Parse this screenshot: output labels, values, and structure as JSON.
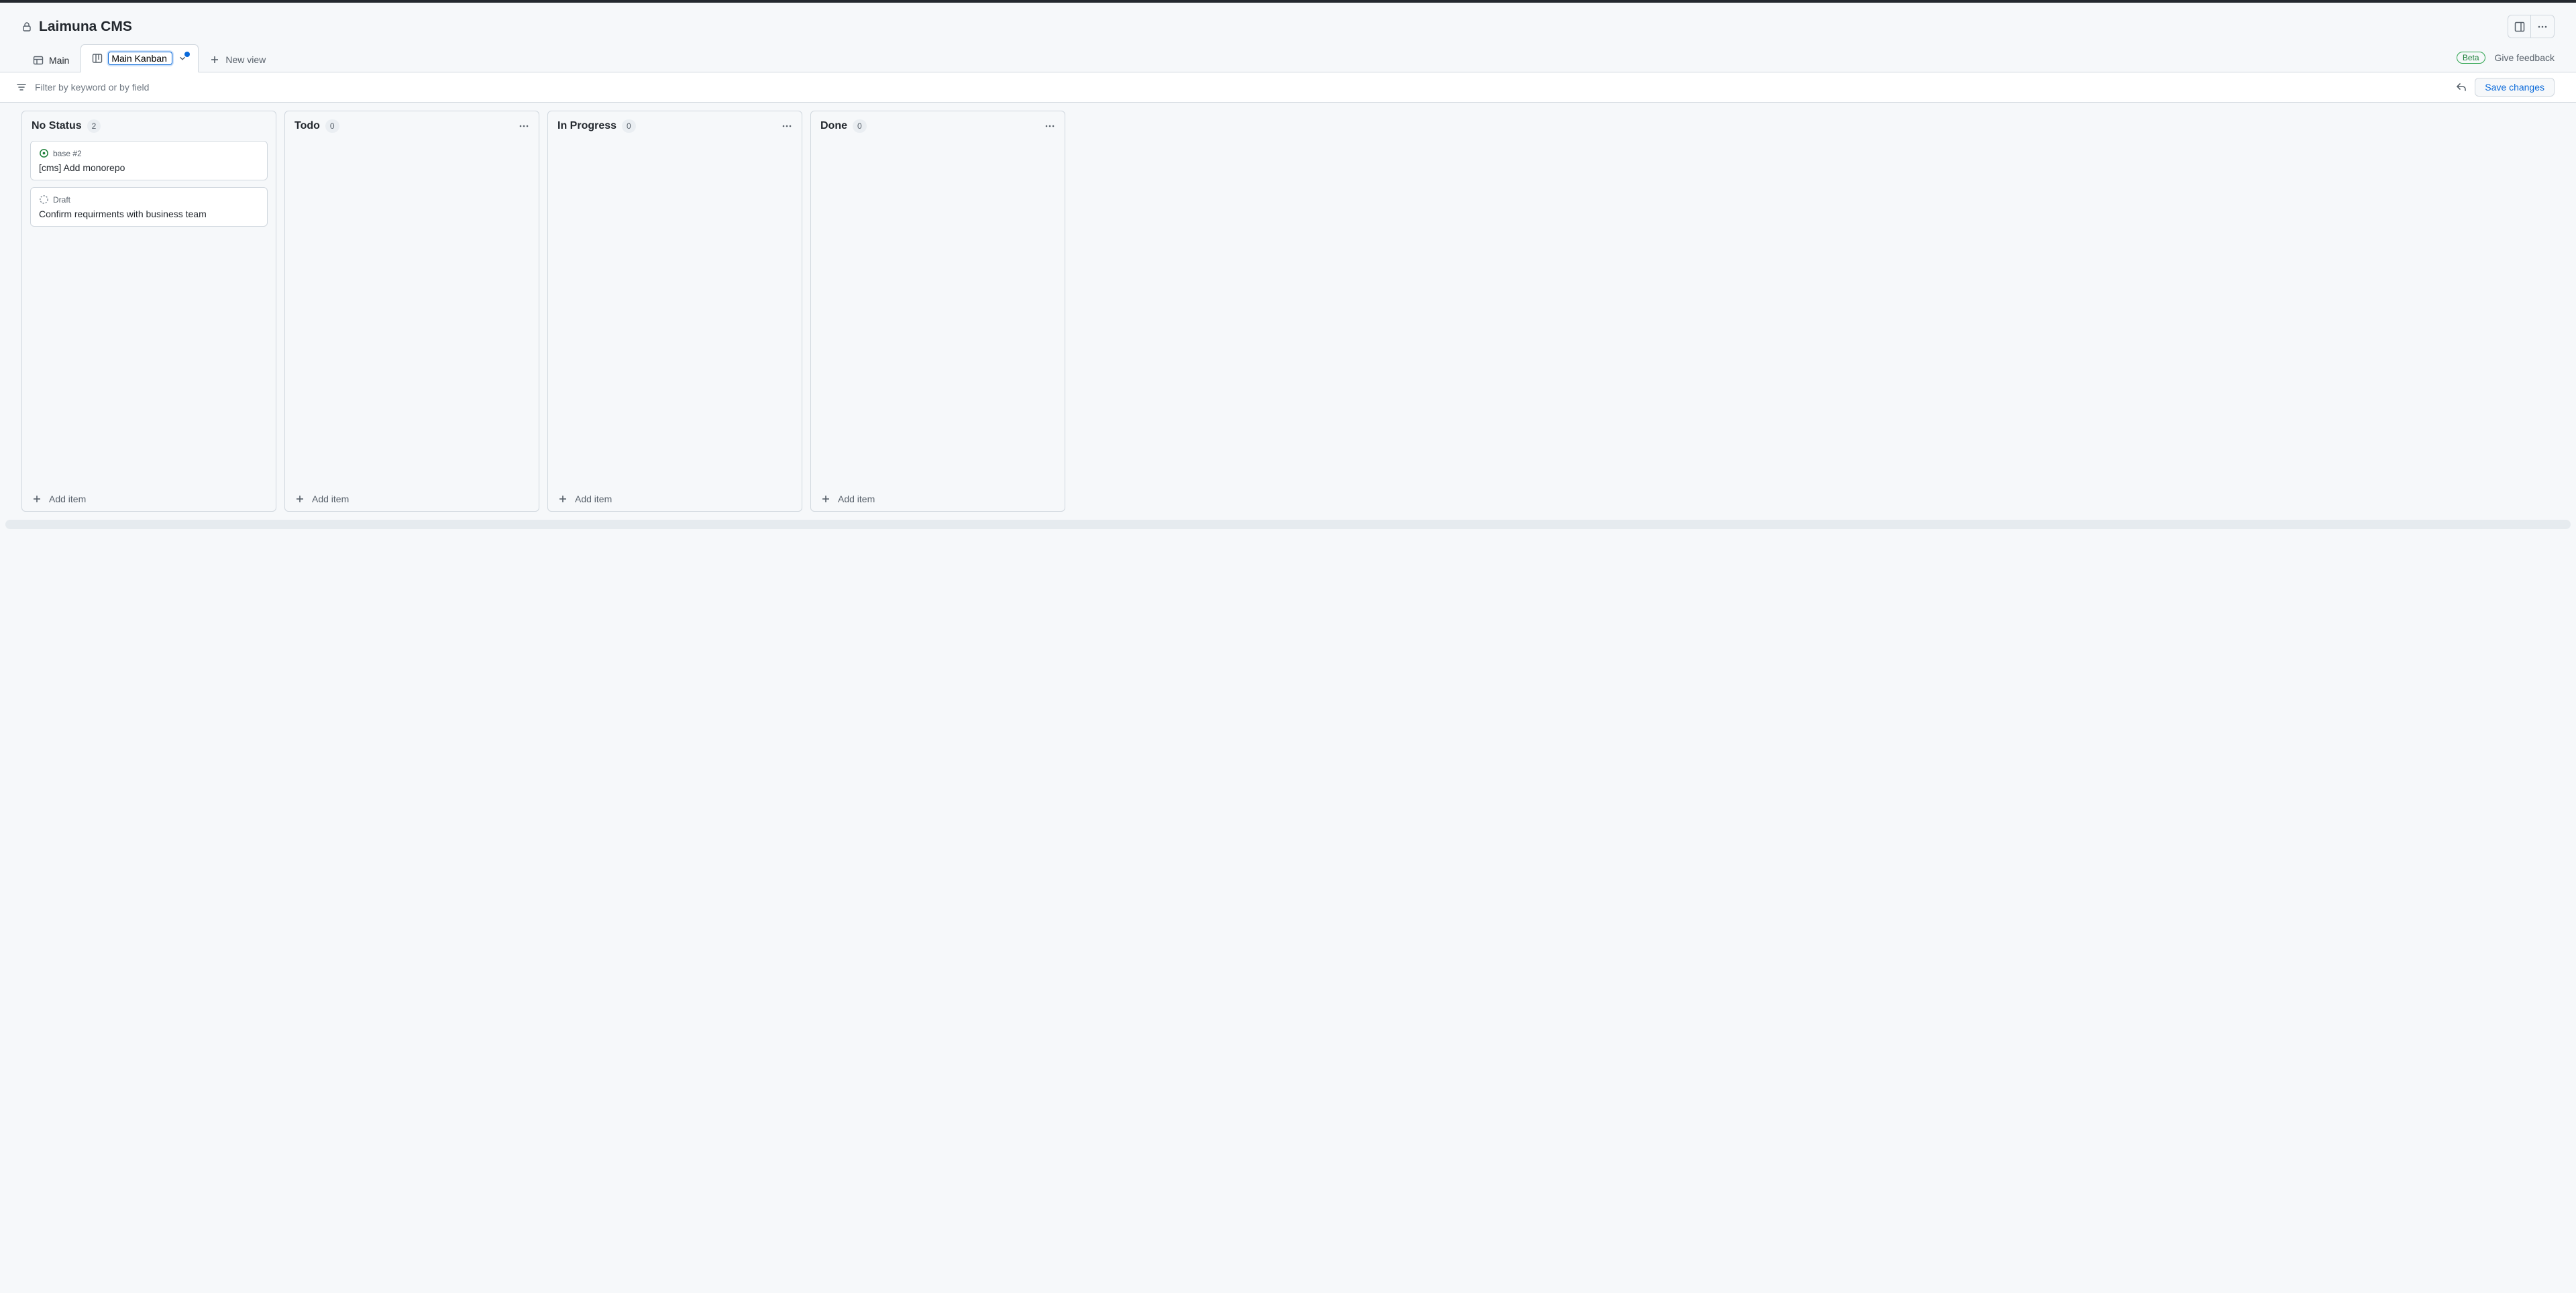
{
  "header": {
    "title": "Laimuna CMS"
  },
  "tabs": [
    {
      "label": "Main",
      "active": false
    },
    {
      "label": "Main Kanban",
      "active": true
    }
  ],
  "new_view_label": "New view",
  "beta_label": "Beta",
  "feedback_label": "Give feedback",
  "filter_placeholder": "Filter by keyword or by field",
  "save_label": "Save changes",
  "columns": [
    {
      "title": "No Status",
      "count": "2",
      "show_menu": false,
      "cards": [
        {
          "icon": "issue-open",
          "meta": "base #2",
          "title": "[cms] Add monorepo"
        },
        {
          "icon": "draft",
          "meta": "Draft",
          "title": "Confirm requirments with business team"
        }
      ],
      "add_label": "Add item"
    },
    {
      "title": "Todo",
      "count": "0",
      "show_menu": true,
      "cards": [],
      "add_label": "Add item"
    },
    {
      "title": "In Progress",
      "count": "0",
      "show_menu": true,
      "cards": [],
      "add_label": "Add item"
    },
    {
      "title": "Done",
      "count": "0",
      "show_menu": true,
      "cards": [],
      "add_label": "Add item"
    }
  ]
}
